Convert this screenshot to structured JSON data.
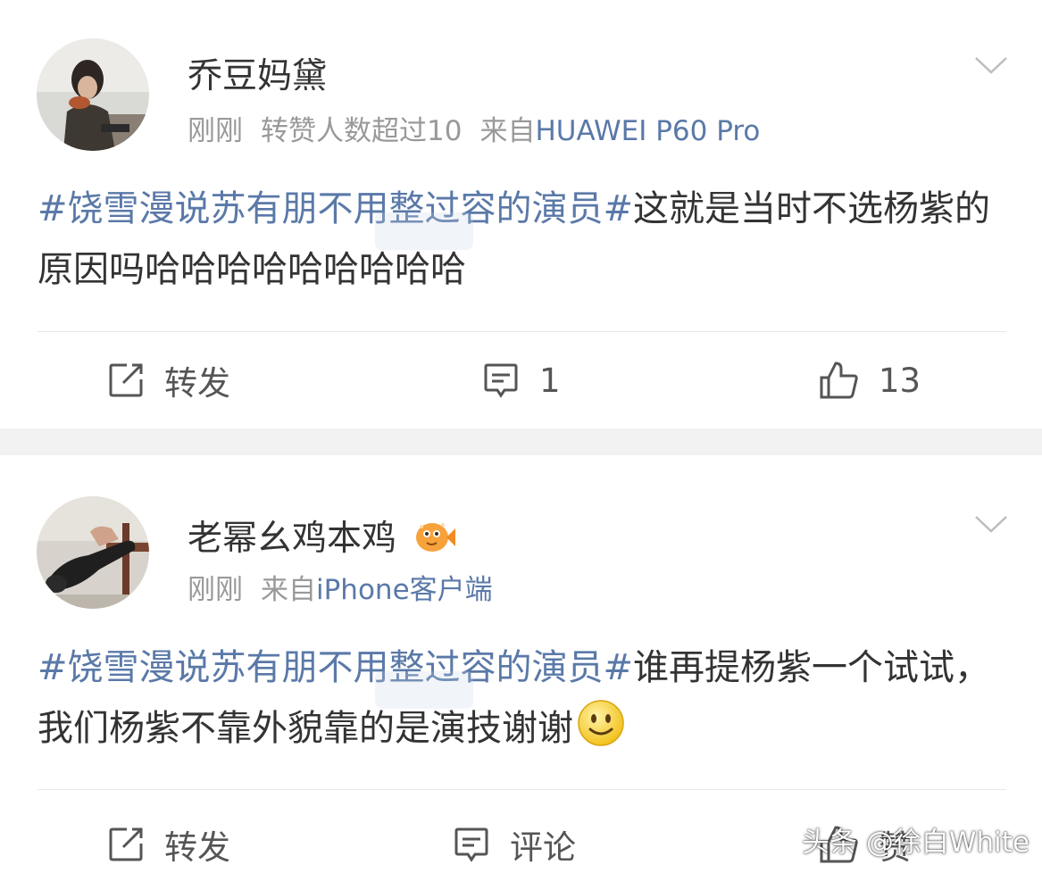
{
  "posts": [
    {
      "username": "乔豆妈黛",
      "time": "刚刚",
      "repost_note": "转赞人数超过10",
      "source_prefix": "来自",
      "source_device": "HUAWEI P60 Pro",
      "topic": "#饶雪漫说苏有朋不用整过容的演员#",
      "text": "这就是当时不选杨紫的原因吗哈哈哈哈哈哈哈哈哈",
      "actions": {
        "repost": "转发",
        "comment": "1",
        "like": "13"
      }
    },
    {
      "username": "老幂幺鸡本鸡",
      "time": "刚刚",
      "source_prefix": "来自",
      "source_device": "iPhone客户端",
      "topic": "#饶雪漫说苏有朋不用整过容的演员#",
      "text": "谁再提杨紫一个试试，我们杨紫不靠外貌靠的是演技谢谢",
      "actions": {
        "repost": "转发",
        "comment": "评论",
        "like": "赞"
      }
    }
  ],
  "watermark": "头条 @徐白White",
  "colors": {
    "link": "#5a79a8",
    "text": "#333333",
    "meta": "#999999",
    "gap": "#f2f2f2"
  },
  "icons": [
    "repost-icon",
    "comment-icon",
    "like-icon",
    "chevron-down-icon",
    "fish-badge-icon",
    "smiley-emoji-icon"
  ]
}
